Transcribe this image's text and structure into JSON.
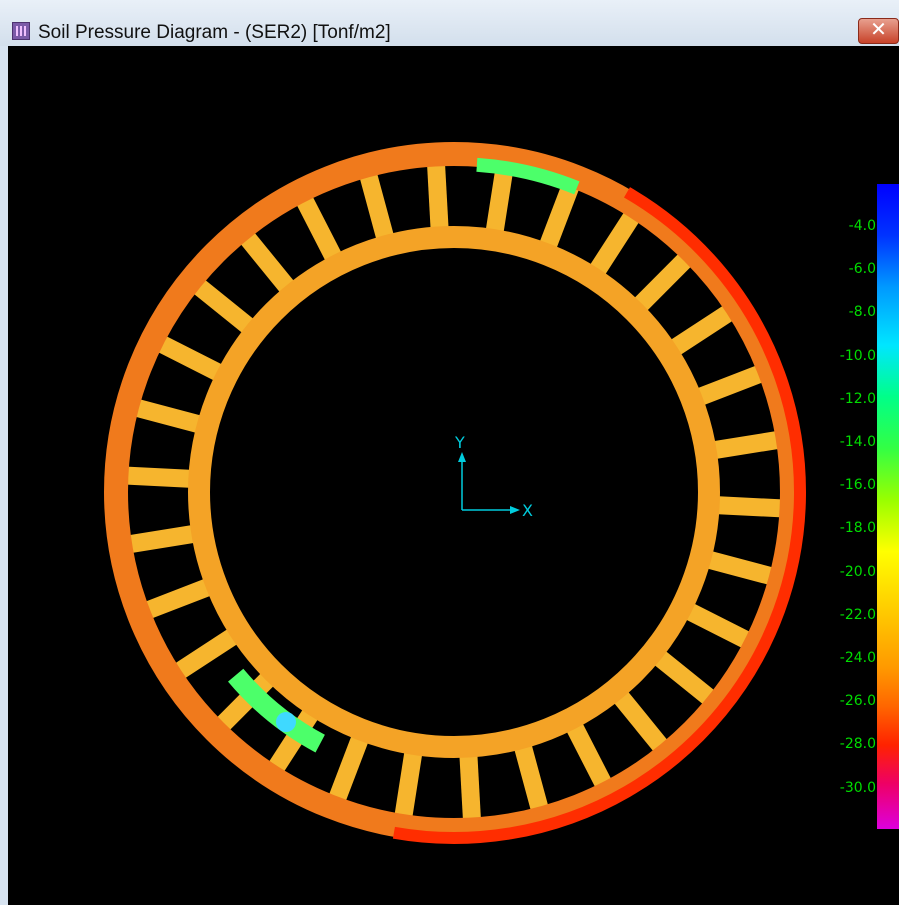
{
  "window": {
    "title": "Soil Pressure Diagram - (SER2)  [Tonf/m2]",
    "close_label": "✕"
  },
  "axes": {
    "y_label": "Y",
    "x_label": "X"
  },
  "legend": {
    "labels": [
      "-4.0",
      "-6.0",
      "-8.0",
      "-10.0",
      "-12.0",
      "-14.0",
      "-16.0",
      "-18.0",
      "-20.0",
      "-22.0",
      "-24.0",
      "-26.0",
      "-28.0",
      "-30.0"
    ]
  },
  "colors": {
    "outer_ring": "#f07a1c",
    "inner_ring": "#f4a326",
    "spoke": "#f6b52e",
    "hot": "#ff2d00",
    "cool": "#4cff6a",
    "cyan": "#3fd9ff",
    "legend_text": "#00dd00"
  }
}
